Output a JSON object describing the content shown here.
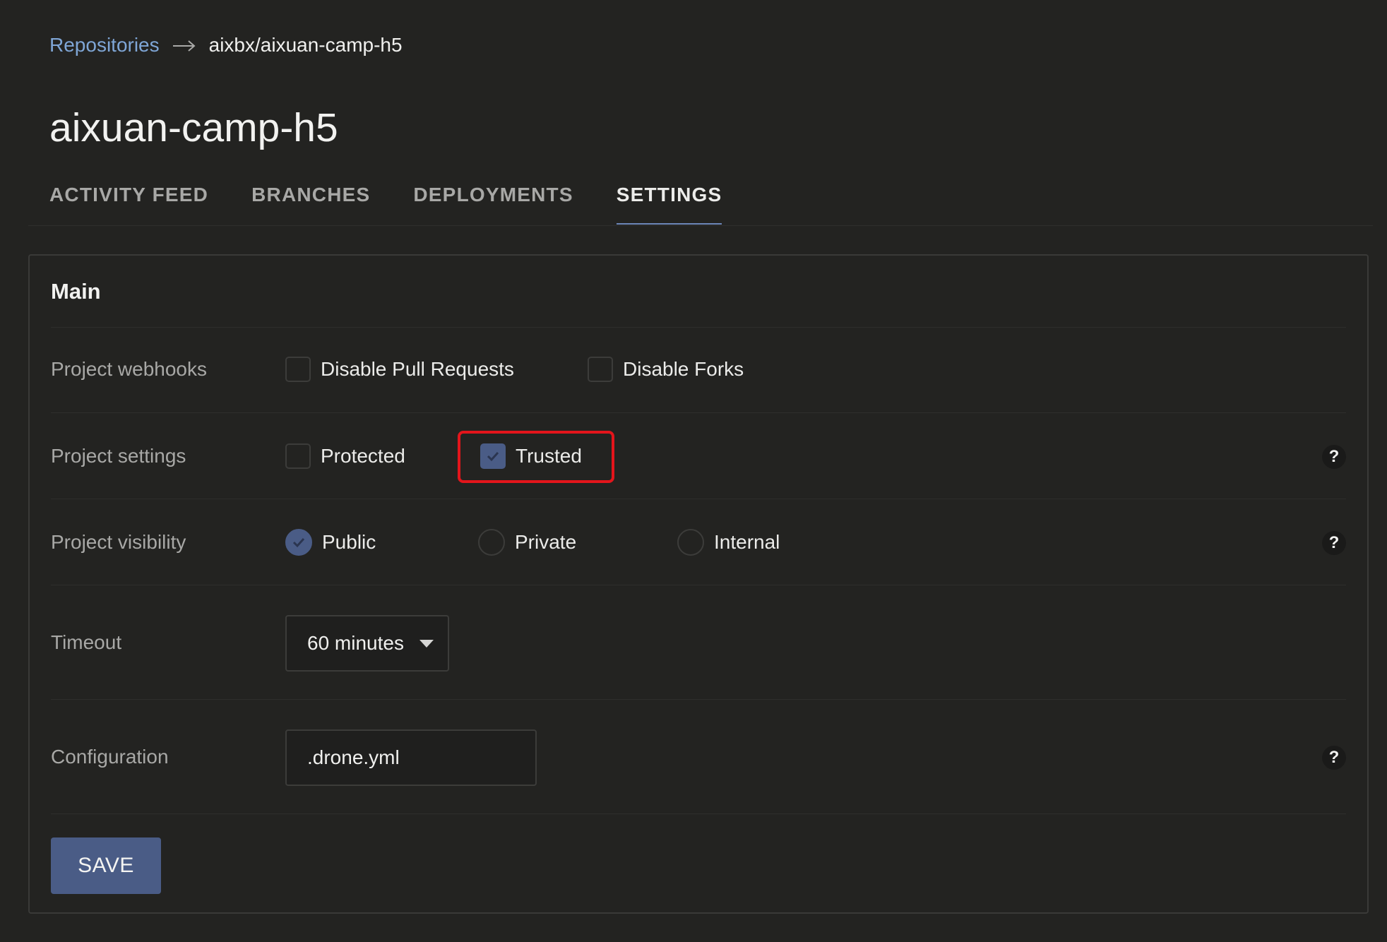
{
  "breadcrumb": {
    "link_label": "Repositories",
    "arrow_icon": "arrow-right-icon",
    "current": "aixbx/aixuan-camp-h5"
  },
  "page_title": "aixuan-camp-h5",
  "tabs": [
    {
      "label": "ACTIVITY FEED",
      "active": false
    },
    {
      "label": "BRANCHES",
      "active": false
    },
    {
      "label": "DEPLOYMENTS",
      "active": false
    },
    {
      "label": "SETTINGS",
      "active": true
    }
  ],
  "panel": {
    "heading": "Main",
    "webhooks": {
      "label": "Project webhooks",
      "options": [
        {
          "label": "Disable Pull Requests",
          "checked": false
        },
        {
          "label": "Disable Forks",
          "checked": false
        }
      ]
    },
    "settings": {
      "label": "Project settings",
      "options": [
        {
          "label": "Protected",
          "checked": false
        },
        {
          "label": "Trusted",
          "checked": true,
          "highlighted": true
        }
      ],
      "help": "?"
    },
    "visibility": {
      "label": "Project visibility",
      "options": [
        {
          "label": "Public",
          "selected": true
        },
        {
          "label": "Private",
          "selected": false
        },
        {
          "label": "Internal",
          "selected": false
        }
      ],
      "help": "?"
    },
    "timeout": {
      "label": "Timeout",
      "value": "60 minutes"
    },
    "configuration": {
      "label": "Configuration",
      "value": ".drone.yml",
      "help": "?"
    },
    "save_label": "SAVE"
  },
  "colors": {
    "background": "#232321",
    "accent": "#4a5c86",
    "link": "#7fa6d6",
    "highlight": "#e3151b"
  }
}
